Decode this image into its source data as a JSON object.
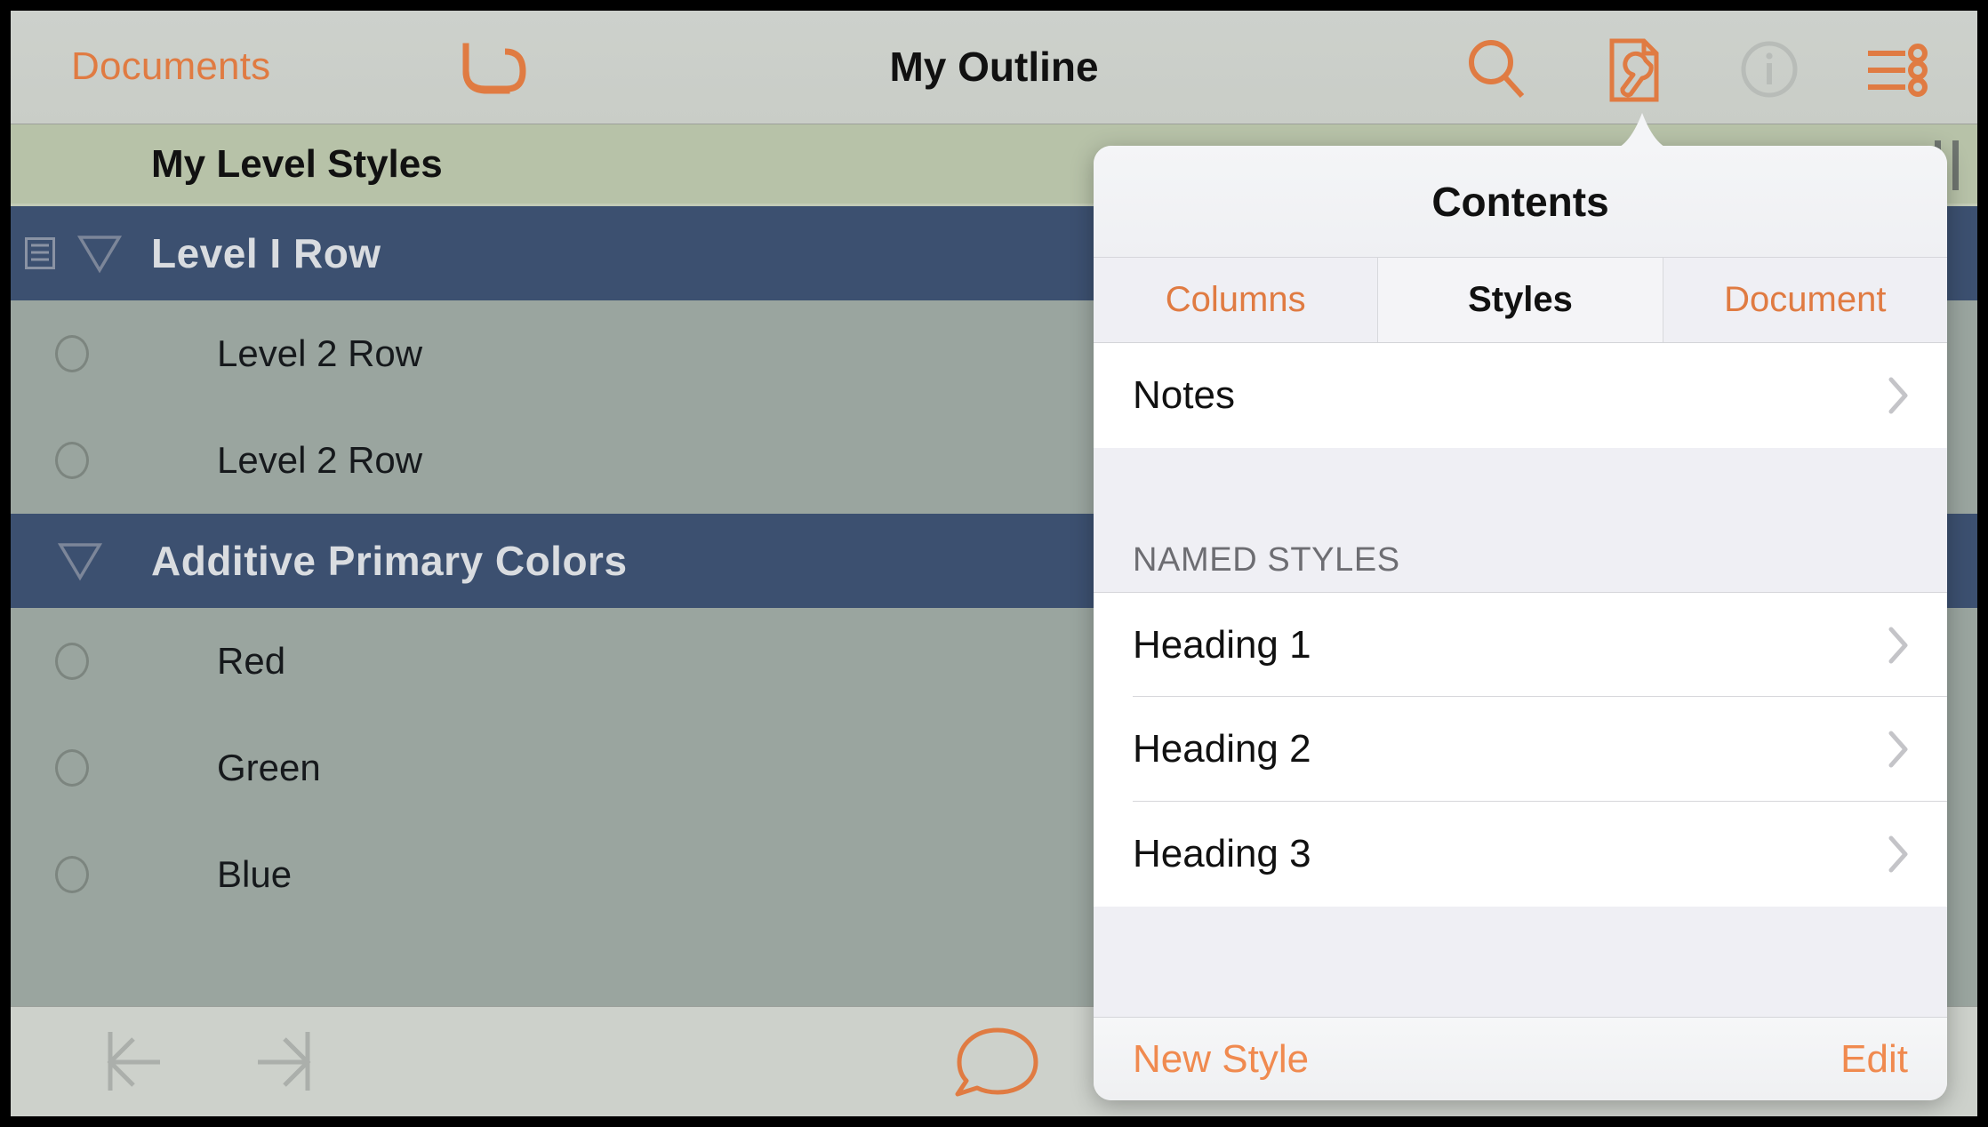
{
  "colors": {
    "accent_orange": "#E07B42",
    "level1_row_bg": "#3C5070",
    "level2_row_bg": "#9AA59F",
    "header_band_bg": "#B7C2A8",
    "toolbar_bg": "#CDD1CC",
    "popover_bg": "#FFFFFF",
    "tab_bar_bg": "#EFEFF4"
  },
  "toolbar": {
    "back_label": "Documents",
    "title": "My Outline",
    "undo_icon": "undo-arrow-icon",
    "search_icon": "search-icon",
    "contents_icon": "document-wrench-icon",
    "info_icon": "info-circle-icon",
    "more_icon": "list-settings-icon"
  },
  "outline": {
    "column_header": {
      "label": "My Level Styles",
      "resize_handle_icon": "column-resize-handle-icon"
    },
    "rows": [
      {
        "label": "Level I Row",
        "level": 1,
        "has_note": true,
        "note_icon": "note-lines-icon",
        "disclosure_icon": "triangle-down-icon",
        "bullet_icon": "triangle-down-icon"
      },
      {
        "label": "Level 2 Row",
        "level": 2,
        "has_note": false,
        "bullet_icon": "circle-bullet-icon"
      },
      {
        "label": "Level 2 Row",
        "level": 2,
        "has_note": false,
        "bullet_icon": "circle-bullet-icon"
      },
      {
        "label": "Additive Primary Colors",
        "level": 1,
        "has_note": false,
        "disclosure_icon": "triangle-down-icon",
        "bullet_icon": "triangle-down-icon"
      },
      {
        "label": "Red",
        "level": 2,
        "has_note": false,
        "bullet_icon": "circle-bullet-icon"
      },
      {
        "label": "Green",
        "level": 2,
        "has_note": false,
        "bullet_icon": "circle-bullet-icon"
      },
      {
        "label": "Blue",
        "level": 2,
        "has_note": false,
        "bullet_icon": "circle-bullet-icon"
      }
    ]
  },
  "bottom_toolbar": {
    "outdent_icon": "outdent-arrow-icon",
    "indent_icon": "indent-arrow-icon",
    "comment_icon": "speech-bubble-icon"
  },
  "popover": {
    "title": "Contents",
    "tabs": [
      {
        "label": "Columns",
        "active": false
      },
      {
        "label": "Styles",
        "active": true
      },
      {
        "label": "Document",
        "active": false
      }
    ],
    "top_group": [
      {
        "label": "Notes",
        "chevron_icon": "chevron-right-icon"
      }
    ],
    "section_header": "NAMED STYLES",
    "named_styles": [
      {
        "label": "Heading 1",
        "chevron_icon": "chevron-right-icon"
      },
      {
        "label": "Heading 2",
        "chevron_icon": "chevron-right-icon"
      },
      {
        "label": "Heading 3",
        "chevron_icon": "chevron-right-icon"
      }
    ],
    "footer": {
      "new_style_label": "New Style",
      "edit_label": "Edit"
    }
  }
}
